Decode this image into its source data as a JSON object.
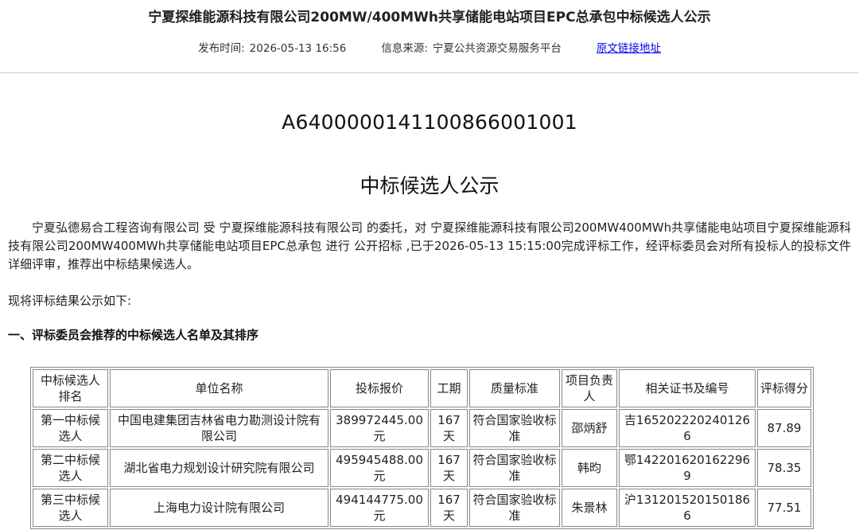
{
  "header": {
    "title": "宁夏探维能源科技有限公司200MW/400MWh共享储能电站项目EPC总承包中标候选人公示",
    "publish_label": "发布时间:",
    "publish_time": "2026-05-13 16:56",
    "source_label": "信息来源:",
    "source_value": "宁夏公共资源交易服务平台",
    "original_link": "原文链接地址"
  },
  "document": {
    "number": "A6400000141100866001001",
    "heading": "中标候选人公示",
    "intro": "宁夏弘德易合工程咨询有限公司 受 宁夏探维能源科技有限公司 的委托，对 宁夏探维能源科技有限公司200MW400MWh共享储能电站项目宁夏探维能源科技有限公司200MW400MWh共享储能电站项目EPC总承包 进行 公开招标 ,已于2026-05-13 15:15:00完成评标工作，经评标委员会对所有投标人的投标文件详细评审，推荐出中标结果候选人。",
    "lead": "现将评标结果公示如下:",
    "section_title": "一、评标委员会推荐的中标候选人名单及其排序"
  },
  "table": {
    "headers": [
      "中标候选人排名",
      "单位名称",
      "投标报价",
      "工期",
      "质量标准",
      "项目负责人",
      "相关证书及编号",
      "评标得分"
    ],
    "rows": [
      [
        "第一中标候选人",
        "中国电建集团吉林省电力勘测设计院有限公司",
        "389972445.00元",
        "167天",
        "符合国家验收标准",
        "邵炳舒",
        "吉1652022202401266",
        "87.89"
      ],
      [
        "第二中标候选人",
        "湖北省电力规划设计研究院有限公司",
        "495945488.00元",
        "167天",
        "符合国家验收标准",
        "韩昀",
        "鄂1422016201622969",
        "78.35"
      ],
      [
        "第三中标候选人",
        "上海电力设计院有限公司",
        "494144775.00元",
        "167天",
        "符合国家验收标准",
        "朱景林",
        "沪1312015201501866",
        "77.51"
      ]
    ]
  }
}
